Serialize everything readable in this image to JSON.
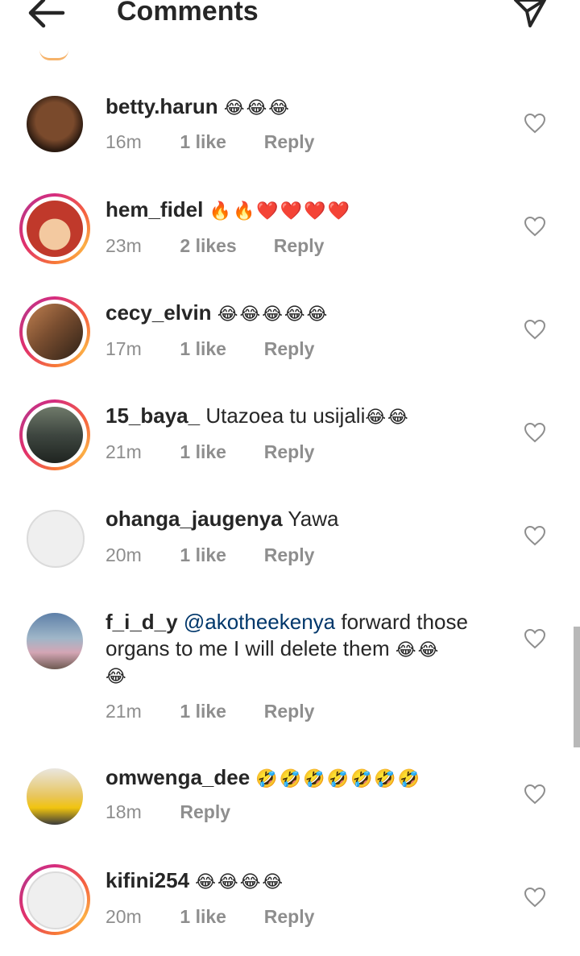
{
  "header": {
    "title": "Comments"
  },
  "comments": [
    {
      "username": "betty.harun",
      "text": "",
      "emojis": "😂😂😂",
      "time": "16m",
      "likes": "1 like",
      "reply": "Reply",
      "has_ring": false,
      "avatar": "#5a3a22"
    },
    {
      "username": "hem_fidel",
      "text": "",
      "emojis": "🔥🔥❤️❤️❤️❤️",
      "time": "23m",
      "likes": "2 likes",
      "reply": "Reply",
      "has_ring": true,
      "avatar": "#c0392b"
    },
    {
      "username": "cecy_elvin",
      "text": "",
      "emojis": "😂😂😂😂😂",
      "time": "17m",
      "likes": "1 like",
      "reply": "Reply",
      "has_ring": true,
      "avatar": "#6b4a33"
    },
    {
      "username": "15_baya_",
      "text": "Utazoea tu usijali",
      "emojis": "😂😂",
      "time": "21m",
      "likes": "1 like",
      "reply": "Reply",
      "has_ring": true,
      "avatar": "#3f4a45"
    },
    {
      "username": "ohanga_jaugenya",
      "text": "Yawa",
      "emojis": "",
      "time": "20m",
      "likes": "1 like",
      "reply": "Reply",
      "has_ring": false,
      "avatar": ""
    },
    {
      "username": "f_i_d_y",
      "mention": "@akotheekenya",
      "text": "forward those",
      "text2": "organs to me I will delete them",
      "emojis2": "😂😂",
      "emojis3": "😂",
      "time": "21m",
      "likes": "1 like",
      "reply": "Reply",
      "has_ring": false,
      "avatar": "#6c8bb0"
    },
    {
      "username": "omwenga_dee",
      "text": "",
      "emojis": "🤣🤣🤣🤣🤣🤣🤣",
      "time": "18m",
      "reply": "Reply",
      "has_ring": false,
      "avatar": "#f1c40f"
    },
    {
      "username": "kifini254",
      "text": "",
      "emojis": "😂😂😂😂",
      "time": "20m",
      "likes": "1 like",
      "reply": "Reply",
      "has_ring": true,
      "avatar": ""
    }
  ]
}
